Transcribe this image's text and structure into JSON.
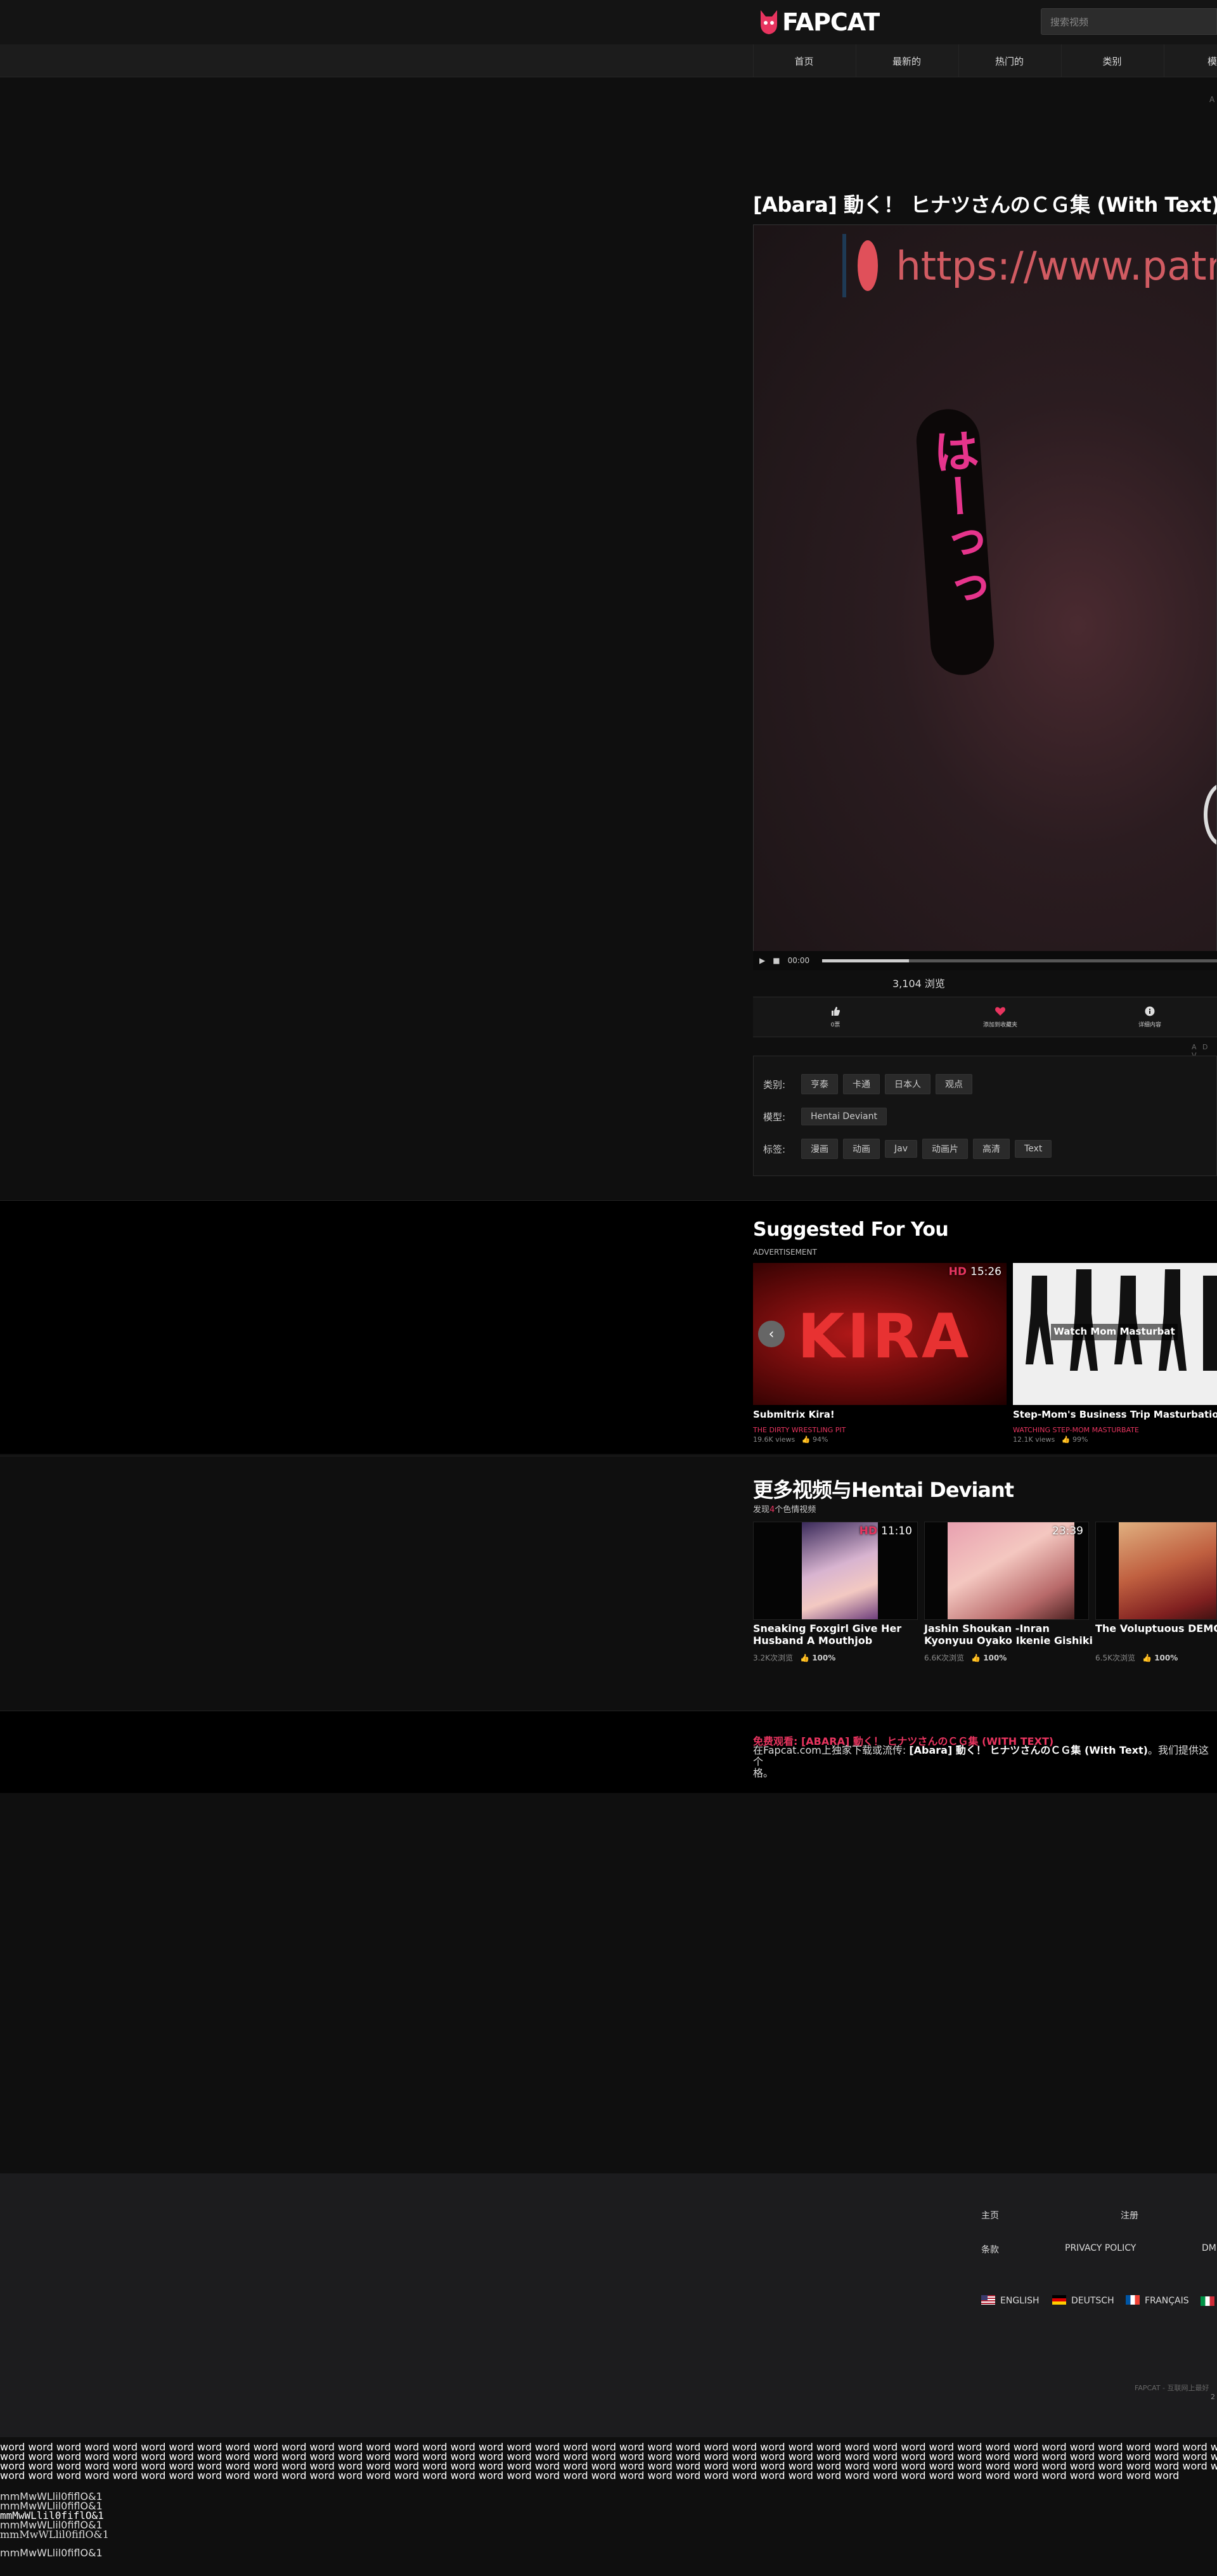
{
  "header": {
    "logo_text": "FAPCAT",
    "search_placeholder": "搜索视频"
  },
  "nav": {
    "items": [
      "首页",
      "最新的",
      "热门的",
      "类别",
      "模"
    ]
  },
  "ad_label": "A",
  "video": {
    "title": "[Abara] 動く！ ヒナツさんのＣＧ集 (With Text)",
    "overlay_url": "https://www.patr",
    "overlay_kana": "はーっっ",
    "time": "00:00",
    "progress": 0.22,
    "views": "3,104 浏览"
  },
  "actions": {
    "like": "0票",
    "favorite": "添加到收藏夹",
    "info": "详细内容",
    "ad_strip": "A D V"
  },
  "meta": {
    "category_label": "类别:",
    "categories": [
      "亨泰",
      "卡通",
      "日本人",
      "观点"
    ],
    "model_label": "模型:",
    "models": [
      "Hentai Deviant"
    ],
    "tags_label": "标签:",
    "tags": [
      "漫画",
      "动画",
      "Jav",
      "动画片",
      "高清",
      "Text"
    ]
  },
  "suggested": {
    "title": "Suggested For You",
    "ad_label": "ADVERTISEMENT",
    "items": [
      {
        "name": "Submitrix Kira!",
        "channel": "THE DIRTY WRESTLING PIT",
        "views": "19.6K views",
        "rating": "94%",
        "hd": "HD",
        "duration": "15:26",
        "thumb_text": "KIRA"
      },
      {
        "name": "Step-Mom's Business Trip Masturbatio",
        "channel": "WATCHING STEP-MOM MASTURBATE",
        "views": "12.1K views",
        "rating": "99%",
        "thumb_text": "Watch Mom Masturbat"
      }
    ]
  },
  "more": {
    "title": "更多视频与Hentai Deviant",
    "sub_prefix": "发现",
    "sub_count": "4",
    "sub_suffix": "个色情视频",
    "items": [
      {
        "name": "Sneaking Foxgirl Give Her Husband A Mouthjob",
        "views": "3.2K次浏览",
        "rating": "100%",
        "hd": "HD",
        "duration": "11:10"
      },
      {
        "name": "Jashin Shoukan -Inran Kyonyuu Oyako Ikenie Gishiki",
        "views": "6.6K次浏览",
        "rating": "100%",
        "duration": "23:39"
      },
      {
        "name": "The Voluptuous DEMO QUEEN And Our Shoe",
        "views": "6.5K次浏览",
        "rating": "100%"
      }
    ]
  },
  "download": {
    "title": "免费观看: [ABARA] 動く！ ヒナツさんのＣＧ集 (WITH TEXT)",
    "text_prefix": "在Fapcat.com上独家下载或流传: ",
    "text_bold": "[Abara] 動く！ ヒナツさんのＣＧ集 (With Text)",
    "text_suffix": "。我们提供这个",
    "text_line2": "格。"
  },
  "footer": {
    "links_row1": [
      "主页",
      "注册"
    ],
    "links_row2": [
      "条款",
      "PRIVACY POLICY",
      "DM"
    ],
    "languages": [
      "ENGLISH",
      "DEUTSCH",
      "FRANÇAIS"
    ],
    "copyright": "FAPCAT - 互联网上最好",
    "copyright2": "2"
  },
  "junk": {
    "words_line": "word word word word word word word word word word word word word word word word word word word word word word word word word word word word word word word word word word word word word word word word word word word word word word word word word word word word word w",
    "words_line_last": "word word word word word word word word word word word word word word word word word word word word word word word word word word word word word word word word word word word word word word word word word word",
    "glyph_lines": [
      "mmMwWLlil0fiflO&1",
      "mmMwWLlil0fiflO&1",
      "mmMwWLlil0fiflO&1",
      "mmMwWLlil0fiflO&1",
      "mmMwWLlil0fiflO&1"
    ],
    "glyph_last": "mmMwWLlil0fiflO&1"
  }
}
